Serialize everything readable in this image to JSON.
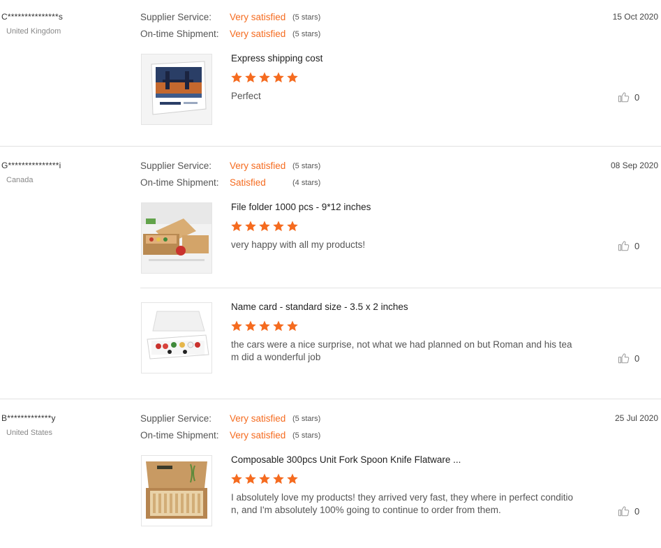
{
  "reviews": [
    {
      "user": "C***************s",
      "country": "United Kingdom",
      "date": "15 Oct 2020",
      "supplier_label": "Supplier Service:",
      "supplier_value": "Very satisfied",
      "supplier_stars": "(5 stars)",
      "shipment_label": "On-time Shipment:",
      "shipment_value": "Very satisfied",
      "shipment_stars": "(5 stars)",
      "items": [
        {
          "title": "Express shipping cost",
          "rating": 5,
          "comment": "Perfect",
          "likes": "0"
        }
      ]
    },
    {
      "user": "G***************i",
      "country": "Canada",
      "date": "08 Sep 2020",
      "supplier_label": "Supplier Service:",
      "supplier_value": "Very satisfied",
      "supplier_stars": "(5 stars)",
      "shipment_label": "On-time Shipment:",
      "shipment_value": "Satisfied",
      "shipment_stars": "(4 stars)",
      "items": [
        {
          "title": "File folder 1000 pcs - 9*12 inches",
          "rating": 5,
          "comment": "very happy with all my products!",
          "likes": "0"
        },
        {
          "title": "Name card - standard size - 3.5 x 2 inches",
          "rating": 5,
          "comment": "the cars were a nice surprise, not what we had planned on but Roman and his tea m did a wonderful job",
          "likes": "0"
        }
      ]
    },
    {
      "user": "B*************y",
      "country": "United States",
      "date": "25 Jul 2020",
      "supplier_label": "Supplier Service:",
      "supplier_value": "Very satisfied",
      "supplier_stars": "(5 stars)",
      "shipment_label": "On-time Shipment:",
      "shipment_value": "Very satisfied",
      "shipment_stars": "(5 stars)",
      "items": [
        {
          "title": "Composable 300pcs Unit Fork Spoon Knife Flatware ...",
          "rating": 5,
          "comment": "I absolutely love my products! they arrived very fast, they where in perfect conditio n, and I'm absolutely 100% going to continue to order from them.",
          "likes": "0"
        }
      ]
    }
  ],
  "icons": {
    "thumbs_up": "thumbs-up-icon",
    "star": "star-icon"
  },
  "colors": {
    "accent": "#f56b1f",
    "star": "#f56b1f",
    "divider": "#e2e2e2"
  }
}
